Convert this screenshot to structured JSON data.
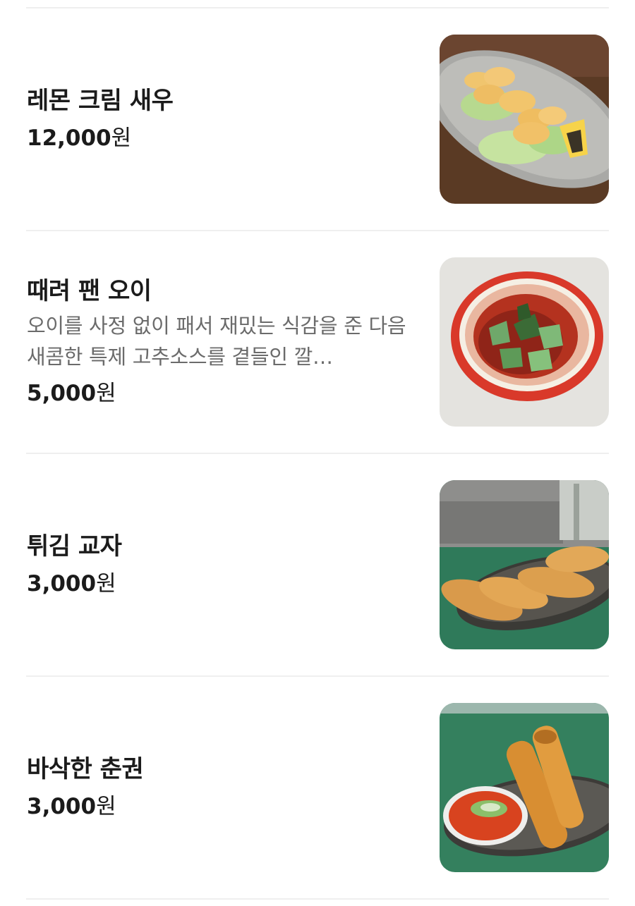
{
  "menu": {
    "items": [
      {
        "name": "레몬 크림 새우",
        "description": "",
        "price": "12,000",
        "currency": "원",
        "image": "lemon-cream-shrimp-photo"
      },
      {
        "name": "때려 팬 오이",
        "description": "오이를 사정 없이 패서 재밌는 식감을 준 다음 새콤한 특제 고추소스를 곁들인 깔…",
        "price": "5,000",
        "currency": "원",
        "image": "smashed-cucumber-photo"
      },
      {
        "name": "튀김 교자",
        "description": "",
        "price": "3,000",
        "currency": "원",
        "image": "fried-gyoza-photo"
      },
      {
        "name": "바삭한 춘권",
        "description": "",
        "price": "3,000",
        "currency": "원",
        "image": "crispy-spring-roll-photo"
      }
    ]
  }
}
